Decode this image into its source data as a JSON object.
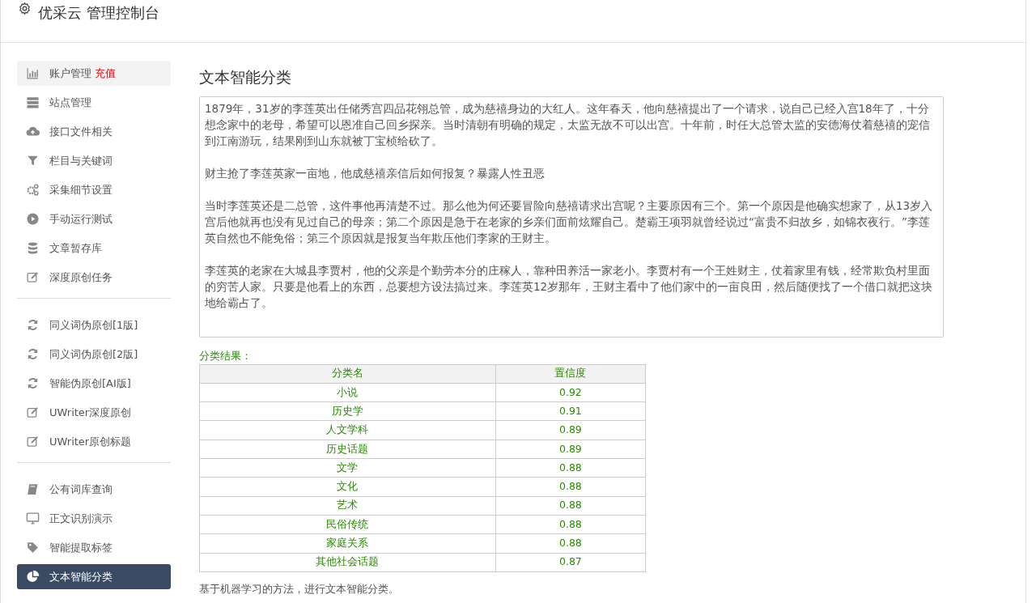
{
  "header": {
    "title": "优采云 管理控制台"
  },
  "sidebar": {
    "groups": [
      {
        "items": [
          {
            "label": "账户管理",
            "badge": "充值",
            "kind": "bar-chart",
            "selected": false,
            "hover": true
          },
          {
            "label": "站点管理",
            "kind": "server",
            "selected": false,
            "hover": false
          },
          {
            "label": "接口文件相关",
            "kind": "cloud-upload",
            "selected": false,
            "hover": false
          },
          {
            "label": "栏目与关键词",
            "kind": "filter",
            "selected": false,
            "hover": false
          },
          {
            "label": "采集细节设置",
            "kind": "gears",
            "selected": false,
            "hover": false
          },
          {
            "label": "手动运行测试",
            "kind": "play",
            "selected": false,
            "hover": false
          },
          {
            "label": "文章暂存库",
            "kind": "database",
            "selected": false,
            "hover": false
          },
          {
            "label": "深度原创任务",
            "kind": "edit",
            "selected": false,
            "hover": false
          }
        ]
      },
      {
        "items": [
          {
            "label": "同义词伪原创[1版]",
            "kind": "refresh",
            "selected": false,
            "hover": false
          },
          {
            "label": "同义词伪原创[2版]",
            "kind": "refresh",
            "selected": false,
            "hover": false
          },
          {
            "label": "智能伪原创[AI版]",
            "kind": "refresh",
            "selected": false,
            "hover": false
          },
          {
            "label": "UWriter深度原创",
            "kind": "edit",
            "selected": false,
            "hover": false
          },
          {
            "label": "UWriter原创标题",
            "kind": "edit",
            "selected": false,
            "hover": false
          }
        ]
      },
      {
        "items": [
          {
            "label": "公有词库查询",
            "kind": "book",
            "selected": false,
            "hover": false
          },
          {
            "label": "正文识别演示",
            "kind": "monitor",
            "selected": false,
            "hover": false
          },
          {
            "label": "智能提取标签",
            "kind": "tag",
            "selected": false,
            "hover": false
          },
          {
            "label": "文本智能分类",
            "kind": "pie-chart",
            "selected": true,
            "hover": false
          }
        ]
      }
    ]
  },
  "main": {
    "title": "文本智能分类",
    "text_input": {
      "paragraphs": [
        "1879年，31岁的李莲英出任储秀宫四品花翎总管，成为慈禧身边的大红人。这年春天，他向慈禧提出了一个请求，说自己已经入宫18年了，十分想念家中的老母，希望可以恩准自己回乡探亲。当时清朝有明确的规定，太监无故不可以出宫。十年前，时任大总管太监的安德海仗着慈禧的宠信到江南游玩，结果刚到山东就被丁宝桢给砍了。",
        "财主抢了李莲英家一亩地，他成慈禧亲信后如何报复？暴露人性丑恶",
        "当时李莲英还是二总管，这件事他再清楚不过。那么他为何还要冒险向慈禧请求出宫呢？主要原因有三个。第一个原因是他确实想家了，从13岁入宫后他就再也没有见过自己的母亲；第二个原因是急于在老家的乡亲们面前炫耀自己。楚霸王项羽就曾经说过“富贵不归故乡，如锦衣夜行。”李莲英自然也不能免俗；第三个原因就是报复当年欺压他们李家的王财主。",
        "李莲英的老家在大城县李贾村，他的父亲是个勤劳本分的庄稼人，靠种田养活一家老小。李贾村有一个王姓财主，仗着家里有钱，经常欺负村里面的穷苦人家。只要是他看上的东西，总要想方设法搞过来。李莲英12岁那年，王财主看中了他们家中的一亩良田，然后随便找了一个借口就把这块地给霸占了。"
      ]
    },
    "result_label": "分类结果：",
    "table": {
      "columns": [
        "分类名",
        "置信度"
      ],
      "rows": [
        [
          "小说",
          "0.92"
        ],
        [
          "历史学",
          "0.91"
        ],
        [
          "人文学科",
          "0.89"
        ],
        [
          "历史话题",
          "0.89"
        ],
        [
          "文学",
          "0.88"
        ],
        [
          "文化",
          "0.88"
        ],
        [
          "艺术",
          "0.88"
        ],
        [
          "民俗传统",
          "0.88"
        ],
        [
          "家庭关系",
          "0.88"
        ],
        [
          "其他社会话题",
          "0.87"
        ]
      ]
    },
    "footer_note": "基于机器学习的方法，进行文本智能分类。"
  }
}
